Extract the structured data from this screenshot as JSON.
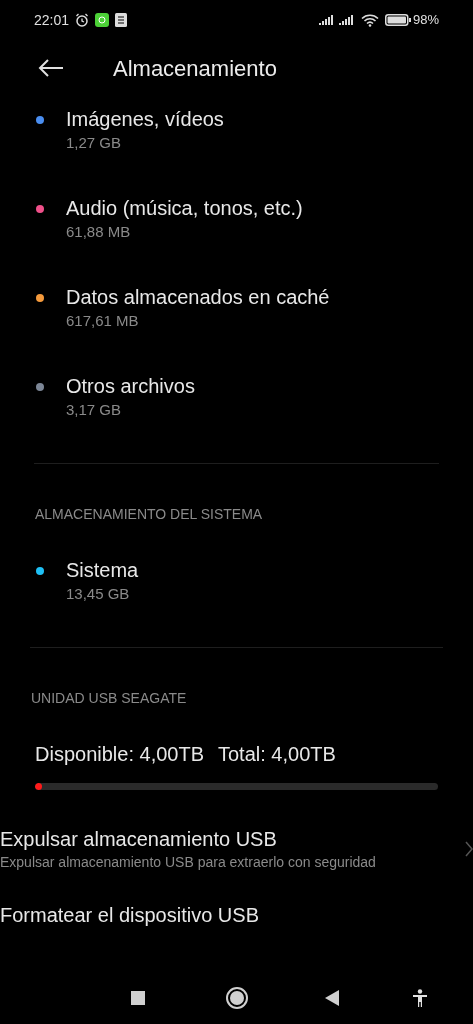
{
  "status_bar": {
    "time": "22:01",
    "battery": "98%"
  },
  "header": {
    "title": "Almacenamiento"
  },
  "categories": [
    {
      "name": "Imágenes, vídeos",
      "size": "1,27 GB",
      "color": "#4a8ef0"
    },
    {
      "name": "Audio (música, tonos, etc.)",
      "size": "61,88 MB",
      "color": "#f0508a"
    },
    {
      "name": "Datos almacenados en caché",
      "size": "617,61 MB",
      "color": "#f59a3c"
    },
    {
      "name": "Otros archivos",
      "size": "3,17 GB",
      "color": "#7c8696"
    }
  ],
  "system_section": {
    "heading": "ALMACENAMIENTO DEL SISTEMA",
    "items": [
      {
        "name": "Sistema",
        "size": "13,45 GB",
        "color": "#1ec0f5"
      }
    ]
  },
  "usb_section": {
    "heading": "UNIDAD USB SEAGATE",
    "available": "Disponible: 4,00TB",
    "total": "Total: 4,00TB",
    "level": 0.01
  },
  "actions": [
    {
      "title": "Expulsar almacenamiento USB",
      "subtitle": "Expulsar almacenamiento USB para extraerlo con seguridad",
      "chevron": true
    },
    {
      "title": "Formatear el dispositivo USB",
      "chevron": false
    }
  ]
}
